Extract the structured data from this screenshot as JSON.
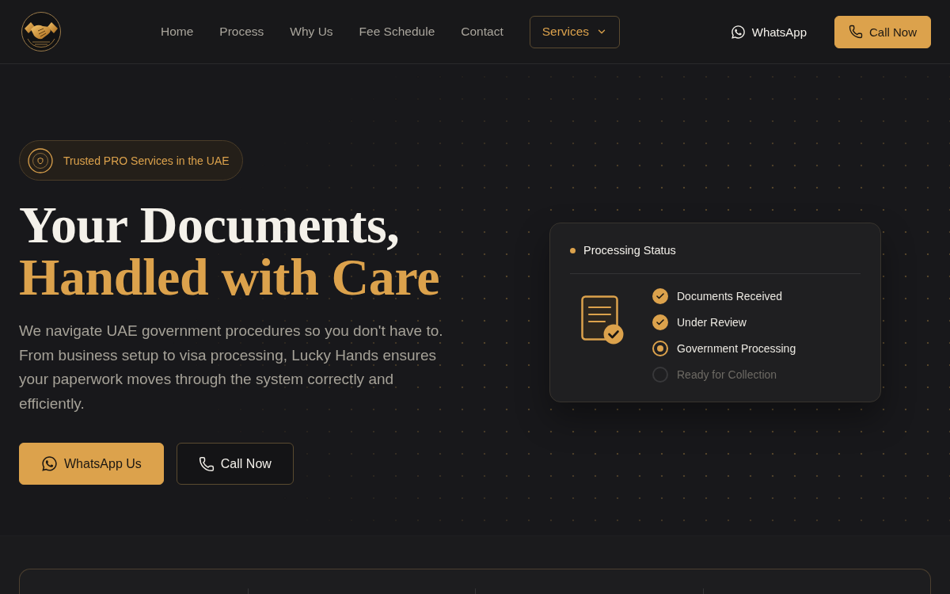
{
  "nav": {
    "links": [
      {
        "label": "Home"
      },
      {
        "label": "Process"
      },
      {
        "label": "Why Us"
      },
      {
        "label": "Fee Schedule"
      },
      {
        "label": "Contact"
      }
    ],
    "dropdown": {
      "label": "Services"
    },
    "actions": [
      {
        "kind": "whatsapp",
        "label": "WhatsApp"
      },
      {
        "kind": "phone",
        "label": "Call Now"
      }
    ]
  },
  "hero": {
    "badge": "Trusted PRO Services in the UAE",
    "title_lines": [
      {
        "text": "Your Documents,",
        "accent": false
      },
      {
        "text": "Handled with Care",
        "accent": true
      }
    ],
    "description": "We navigate UAE government procedures so you don't have to. From business setup to visa processing, Lucky Hands ensures your paperwork moves through the system correctly and efficiently.",
    "buttons": [
      {
        "kind": "whatsapp",
        "label": "WhatsApp Us"
      },
      {
        "kind": "phone",
        "label": "Call Now"
      }
    ]
  },
  "status_card": {
    "title": "Processing Status",
    "steps": [
      {
        "label": "Documents Received",
        "kind": "complete"
      },
      {
        "label": "Under Review",
        "kind": "complete"
      },
      {
        "label": "Government Processing",
        "kind": "current"
      },
      {
        "label": "Ready for Collection",
        "kind": "upcoming"
      }
    ]
  }
}
